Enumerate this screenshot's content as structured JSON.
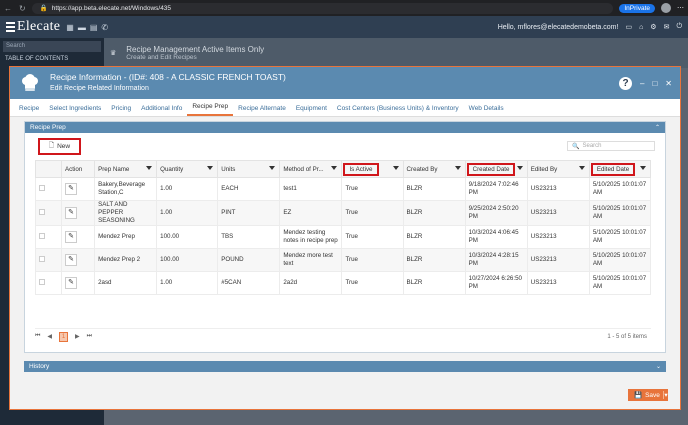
{
  "browser": {
    "url": "https://app.beta.elecate.net/Windows/435",
    "inprivate": "InPrivate"
  },
  "app": {
    "logo": "Elecate",
    "user": "Hello, mflores@elecatedemobeta.com!"
  },
  "sidebar": {
    "search": "Search",
    "toc": "TABLE OF CONTENTS"
  },
  "header": {
    "title": "Recipe Management Active Items Only",
    "subtitle": "Create and Edit Recipes"
  },
  "modal": {
    "title": "Recipe Information - (ID#: 408 - A CLASSIC FRENCH TOAST)",
    "subtitle": "Edit Recipe Related Information",
    "tabs": [
      "Recipe",
      "Select Ingredients",
      "Pricing",
      "Additional Info",
      "Recipe Prep",
      "Recipe Alternate",
      "Equipment",
      "Cost Centers (Business Units) & Inventory",
      "Web Details"
    ],
    "active_tab": "Recipe Prep",
    "panel_title": "Recipe Prep",
    "new_label": "New",
    "search_placeholder": "Search",
    "columns": [
      "Action",
      "Prep Name",
      "Quantity",
      "Units",
      "Method of Pr...",
      "Is Active",
      "Created By",
      "Created Date",
      "Edited By",
      "Edited Date"
    ],
    "rows": [
      {
        "name": "Bakery,Beverage Station,C",
        "qty": "1.00",
        "units": "EACH",
        "method": "test1",
        "active": "True",
        "cby": "BLZR",
        "cdate": "9/18/2024 7:02:46 PM",
        "eby": "US23213",
        "edate": "5/10/2025 10:01:07 AM"
      },
      {
        "name": "SALT AND PEPPER SEASONING",
        "qty": "1.00",
        "units": "PINT",
        "method": "EZ",
        "active": "True",
        "cby": "BLZR",
        "cdate": "9/25/2024 2:50:20 PM",
        "eby": "US23213",
        "edate": "5/10/2025 10:01:07 AM"
      },
      {
        "name": "Mendez Prep",
        "qty": "100.00",
        "units": "TBS",
        "method": "Mendez testing notes in recipe prep",
        "active": "True",
        "cby": "BLZR",
        "cdate": "10/3/2024 4:06:45 PM",
        "eby": "US23213",
        "edate": "5/10/2025 10:01:07 AM"
      },
      {
        "name": "Mendez Prep 2",
        "qty": "100.00",
        "units": "POUND",
        "method": "Mendez more test text",
        "active": "True",
        "cby": "BLZR",
        "cdate": "10/3/2024 4:28:15 PM",
        "eby": "US23213",
        "edate": "5/10/2025 10:01:07 AM"
      },
      {
        "name": "2asd",
        "qty": "1.00",
        "units": "#5CAN",
        "method": "2a2d",
        "active": "True",
        "cby": "BLZR",
        "cdate": "10/27/2024 6:26:50 PM",
        "eby": "US23213",
        "edate": "5/10/2025 10:01:07 AM"
      }
    ],
    "page": "1",
    "items_count": "1 - 5 of 5 items",
    "history": "History",
    "save_label": "Save"
  }
}
